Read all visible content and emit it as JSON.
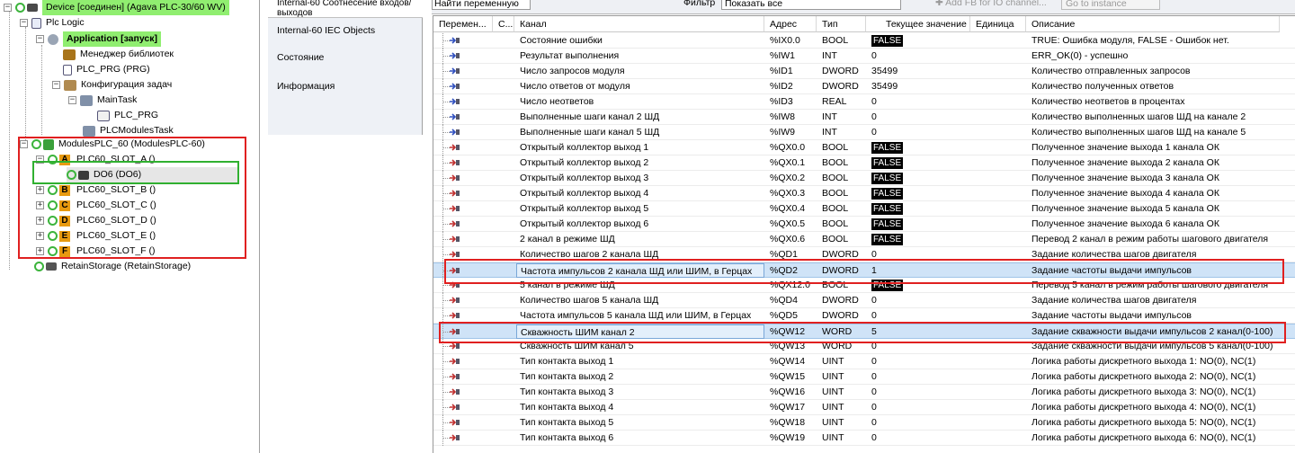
{
  "tree": {
    "device": "Device [соединен] (Agava PLC-30/60 WV)",
    "plc_logic": "Plc Logic",
    "application": "Application [запуск]",
    "library_manager": "Менеджер библиотек",
    "plc_prg": "PLC_PRG (PRG)",
    "task_config": "Конфигурация задач",
    "main_task": "MainTask",
    "plc_prg_call": "PLC_PRG",
    "plc_modules_task": "PLCModulesTask",
    "modules": "ModulesPLC_60 (ModulesPLC-60)",
    "slot_a": "PLC60_SLOT_A ()",
    "do6": "DO6 (DO6)",
    "slot_b": "PLC60_SLOT_B ()",
    "slot_c": "PLC60_SLOT_C ()",
    "slot_d": "PLC60_SLOT_D ()",
    "slot_e": "PLC60_SLOT_E ()",
    "slot_f": "PLC60_SLOT_F ()",
    "retain": "RetainStorage (RetainStorage)",
    "letters": [
      "A",
      "B",
      "C",
      "D",
      "E",
      "F"
    ]
  },
  "tabs": {
    "items": [
      "Internal-60 Соотнесение входов/выходов",
      "Internal-60 IEC Objects",
      "Состояние",
      "Информация"
    ]
  },
  "toolbar": {
    "search": "Найти переменную",
    "filter_label": "Фильтр",
    "filter_value": "Показать все",
    "add_fb": "Add FB for IO channel...",
    "goto": "Go to instance"
  },
  "grid": {
    "headers": [
      "Перемен...",
      "С...",
      "Канал",
      "Адрес",
      "Тип",
      "Текущее значение",
      "Единица",
      "Описание"
    ],
    "rows": [
      {
        "channel": "Состояние ошибки",
        "addr": "%IX0.0",
        "type": "BOOL",
        "value": "FALSE",
        "boxed": true,
        "desc": "TRUE: Ошибка модуля, FALSE - Ошибок нет."
      },
      {
        "channel": "Результат выполнения",
        "addr": "%IW1",
        "type": "INT",
        "value": "0",
        "boxed": false,
        "desc": "ERR_OK(0) - успешно"
      },
      {
        "channel": "Число запросов модуля",
        "addr": "%ID1",
        "type": "DWORD",
        "value": "35499",
        "boxed": false,
        "desc": "Количество отправленных запросов"
      },
      {
        "channel": "Число ответов от модуля",
        "addr": "%ID2",
        "type": "DWORD",
        "value": "35499",
        "boxed": false,
        "desc": "Количество полученных ответов"
      },
      {
        "channel": "Число неответов",
        "addr": "%ID3",
        "type": "REAL",
        "value": "0",
        "boxed": false,
        "desc": "Количество неответов в процентах"
      },
      {
        "channel": "Выполненные шаги канал 2 ШД",
        "addr": "%IW8",
        "type": "INT",
        "value": "0",
        "boxed": false,
        "desc": "Количество выполненных шагов ШД на канале 2"
      },
      {
        "channel": "Выполненные шаги канал 5 ШД",
        "addr": "%IW9",
        "type": "INT",
        "value": "0",
        "boxed": false,
        "desc": "Количество выполненных шагов ШД на канале 5"
      },
      {
        "channel": "Открытый коллектор выход 1",
        "addr": "%QX0.0",
        "type": "BOOL",
        "value": "FALSE",
        "boxed": true,
        "desc": "Полученное значение выхода 1 канала ОК"
      },
      {
        "channel": "Открытый коллектор выход 2",
        "addr": "%QX0.1",
        "type": "BOOL",
        "value": "FALSE",
        "boxed": true,
        "desc": "Полученное значение выхода 2 канала ОК"
      },
      {
        "channel": "Открытый коллектор выход 3",
        "addr": "%QX0.2",
        "type": "BOOL",
        "value": "FALSE",
        "boxed": true,
        "desc": "Полученное значение выхода 3 канала ОК"
      },
      {
        "channel": "Открытый коллектор выход 4",
        "addr": "%QX0.3",
        "type": "BOOL",
        "value": "FALSE",
        "boxed": true,
        "desc": "Полученное значение выхода 4 канала ОК"
      },
      {
        "channel": "Открытый коллектор выход 5",
        "addr": "%QX0.4",
        "type": "BOOL",
        "value": "FALSE",
        "boxed": true,
        "desc": "Полученное значение выхода 5 канала ОК"
      },
      {
        "channel": "Открытый коллектор выход 6",
        "addr": "%QX0.5",
        "type": "BOOL",
        "value": "FALSE",
        "boxed": true,
        "desc": "Полученное значение выхода 6 канала ОК"
      },
      {
        "channel": "2 канал в режиме ШД",
        "addr": "%QX0.6",
        "type": "BOOL",
        "value": "FALSE",
        "boxed": true,
        "desc": "Перевод 2 канал в режим работы шагового двигателя"
      },
      {
        "channel": "Количество шагов 2 канала ШД",
        "addr": "%QD1",
        "type": "DWORD",
        "value": "0",
        "boxed": false,
        "desc": "Задание количества шагов двигателя"
      },
      {
        "channel": "Частота импульсов 2 канала ШД или ШИМ, в Герцах",
        "addr": "%QD2",
        "type": "DWORD",
        "value": "1",
        "boxed": false,
        "desc": "Задание частоты выдачи импульсов",
        "sel": true
      },
      {
        "channel": "5 канал в режиме ШД",
        "addr": "%QX12.0",
        "type": "BOOL",
        "value": "FALSE",
        "boxed": true,
        "desc": "Перевод 5 канал в режим работы шагового двигателя"
      },
      {
        "channel": "Количество шагов 5 канала ШД",
        "addr": "%QD4",
        "type": "DWORD",
        "value": "0",
        "boxed": false,
        "desc": "Задание количества шагов двигателя"
      },
      {
        "channel": "Частота импульсов 5 канала ШД или ШИМ, в Герцах",
        "addr": "%QD5",
        "type": "DWORD",
        "value": "0",
        "boxed": false,
        "desc": "Задание частоты выдачи импульсов"
      },
      {
        "channel": "Скважность ШИМ канал 2",
        "addr": "%QW12",
        "type": "WORD",
        "value": "5",
        "boxed": false,
        "desc": "Задание скважности выдачи импульсов 2 канал(0-100)",
        "sel": true
      },
      {
        "channel": "Скважность ШИМ канал 5",
        "addr": "%QW13",
        "type": "WORD",
        "value": "0",
        "boxed": false,
        "desc": "Задание скважности выдачи импульсов 5 канал(0-100)"
      },
      {
        "channel": "Тип контакта выход 1",
        "addr": "%QW14",
        "type": "UINT",
        "value": "0",
        "boxed": false,
        "desc": "Логика работы дискретного выхода 1: NO(0), NC(1)"
      },
      {
        "channel": "Тип контакта выход 2",
        "addr": "%QW15",
        "type": "UINT",
        "value": "0",
        "boxed": false,
        "desc": "Логика работы дискретного выхода 2: NO(0), NC(1)"
      },
      {
        "channel": "Тип контакта выход 3",
        "addr": "%QW16",
        "type": "UINT",
        "value": "0",
        "boxed": false,
        "desc": "Логика работы дискретного выхода 3: NO(0), NC(1)"
      },
      {
        "channel": "Тип контакта выход 4",
        "addr": "%QW17",
        "type": "UINT",
        "value": "0",
        "boxed": false,
        "desc": "Логика работы дискретного выхода 4: NO(0), NC(1)"
      },
      {
        "channel": "Тип контакта выход 5",
        "addr": "%QW18",
        "type": "UINT",
        "value": "0",
        "boxed": false,
        "desc": "Логика работы дискретного выхода 5: NO(0), NC(1)"
      },
      {
        "channel": "Тип контакта выход 6",
        "addr": "%QW19",
        "type": "UINT",
        "value": "0",
        "boxed": false,
        "desc": "Логика работы дискретного выхода 6: NO(0), NC(1)"
      }
    ]
  },
  "colors": {
    "connected_green": "#90ee70",
    "annotation_red": "#e02020",
    "annotation_green": "#30b030",
    "selection_blue": "#cfe3f7",
    "slot_orange": "#e89a10"
  }
}
